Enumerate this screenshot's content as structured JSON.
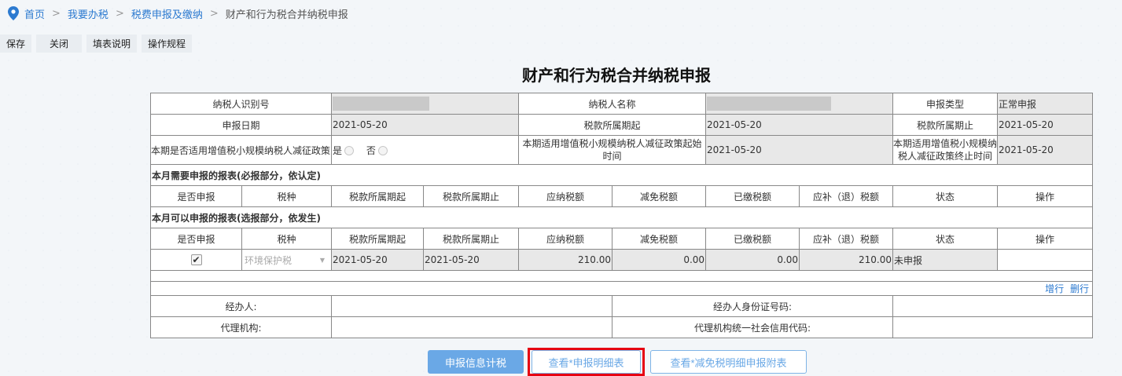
{
  "breadcrumb": {
    "items": [
      "首页",
      "我要办税",
      "税费申报及缴纳"
    ],
    "current": "财产和行为税合并纳税申报",
    "separator": ">"
  },
  "toolbar": {
    "buttons": [
      "保存",
      "关闭",
      "填表说明",
      "操作规程"
    ]
  },
  "form": {
    "title": "财产和行为税合并纳税申报",
    "taxpayer_id_label": "纳税人识别号",
    "taxpayer_name_label": "纳税人名称",
    "declare_type_label": "申报类型",
    "declare_type_value": "正常申报",
    "declare_date_label": "申报日期",
    "declare_date_value": "2021-05-20",
    "period_start_label": "税款所属期起",
    "period_start_value": "2021-05-20",
    "period_end_label": "税款所属期止",
    "period_end_value": "2021-05-20",
    "policy_label": "本期是否适用增值税小规模纳税人减征政策",
    "policy_yes": "是",
    "policy_no": "否",
    "policy_start_label": "本期适用增值税小规模纳税人减征政策起始时间",
    "policy_start_value": "2021-05-20",
    "policy_end_label": "本期适用增值税小规模纳税人减征政策终止时间",
    "policy_end_value": "2021-05-20",
    "required_section": "本月需要申报的报表(必报部分，依认定)",
    "optional_section": "本月可以申报的报表(选报部分，依发生)",
    "columns": [
      "是否申报",
      "税种",
      "税款所属期起",
      "税款所属期止",
      "应纳税额",
      "减免税额",
      "已缴税额",
      "应补（退）税额",
      "状态",
      "操作"
    ],
    "row": {
      "tax_type": "环境保护税",
      "period_start": "2021-05-20",
      "period_end": "2021-05-20",
      "tax_payable": "210.00",
      "tax_reduction": "0.00",
      "tax_paid": "0.00",
      "tax_due": "210.00",
      "status": "未申报"
    },
    "add_row": "增行",
    "delete_row": "删行",
    "handler_label": "经办人:",
    "handler_id_label": "经办人身份证号码:",
    "agency_label": "代理机构:",
    "agency_credit_label": "代理机构统一社会信用代码:"
  },
  "actions": {
    "calc": "申报信息计税",
    "view_detail": "查看*申报明细表",
    "view_reduction": "查看*减免税明细申报附表"
  },
  "colors": {
    "link": "#2c7ad0",
    "primary": "#6aa8e6",
    "highlight": "#e60012",
    "readonly": "#e8e8e8"
  }
}
